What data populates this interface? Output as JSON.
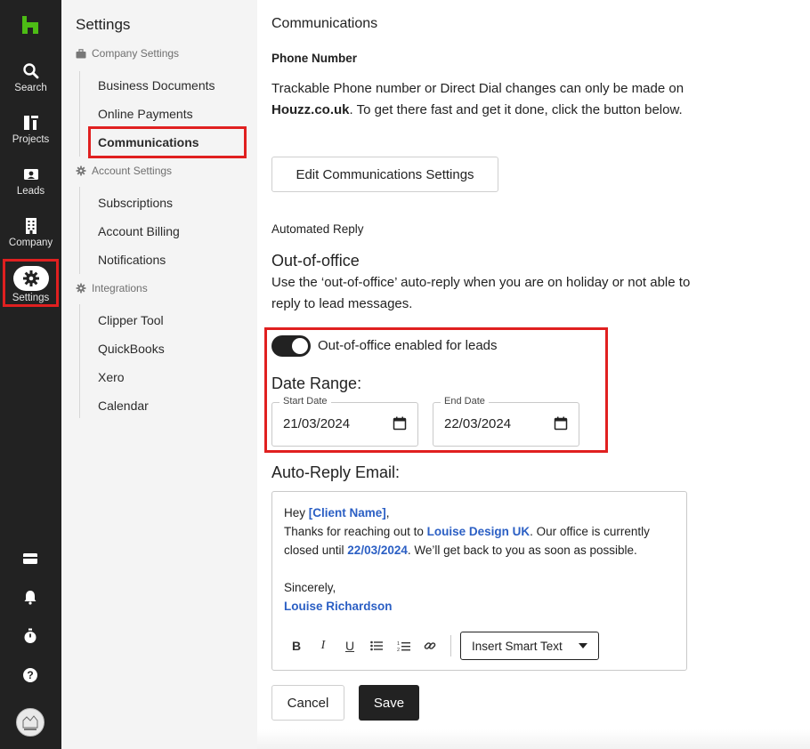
{
  "rail": {
    "items": [
      {
        "label": "Search",
        "icon": "search-icon"
      },
      {
        "label": "Projects",
        "icon": "projects-icon"
      },
      {
        "label": "Leads",
        "icon": "leads-icon"
      },
      {
        "label": "Company",
        "icon": "company-icon"
      },
      {
        "label": "Settings",
        "icon": "gear-icon"
      }
    ],
    "bottom_icons": [
      "inbox-icon",
      "bell-icon",
      "timer-icon",
      "help-icon",
      "avatar"
    ]
  },
  "settings_nav": {
    "title": "Settings",
    "groups": [
      {
        "label": "Company Settings",
        "items": [
          "Business Documents",
          "Online Payments",
          "Communications"
        ]
      },
      {
        "label": "Account Settings",
        "items": [
          "Subscriptions",
          "Account Billing",
          "Notifications"
        ]
      },
      {
        "label": "Integrations",
        "items": [
          "Clipper Tool",
          "QuickBooks",
          "Xero",
          "Calendar"
        ]
      }
    ]
  },
  "main": {
    "title": "Communications",
    "phone_heading": "Phone Number",
    "phone_text_pre": "Trackable Phone number or Direct Dial changes can only be made on ",
    "phone_text_bold": "Houzz.co.uk",
    "phone_text_post": ". To get there fast and get it done, click the button below.",
    "edit_button": "Edit Communications Settings",
    "automated_heading": "Automated Reply",
    "ooo_heading": "Out-of-office",
    "ooo_text": "Use the ‘out-of-office’ auto-reply when you are on holiday or not able to reply to lead messages.",
    "toggle_label": "Out-of-office enabled for leads",
    "toggle_on": true,
    "date_range_heading": "Date Range:",
    "start_date_label": "Start Date",
    "start_date_value": "21/03/2024",
    "end_date_label": "End Date",
    "end_date_value": "22/03/2024",
    "auto_reply_heading": "Auto-Reply Email:",
    "email": {
      "greeting": "Hey ",
      "client_name": "[Client Name]",
      "greeting_end": ",",
      "line2_pre": "Thanks for reaching out to ",
      "company": "Louise Design UK",
      "line2_post": ". Our office is currently closed until ",
      "until_date": "22/03/2024",
      "line2_end": ". We’ll get back to you as soon as possible.",
      "signoff": "Sincerely,",
      "signature": "Louise Richardson"
    },
    "toolbar": {
      "bold": "B",
      "italic": "I",
      "underline": "U",
      "smart_text_button": "Insert Smart Text"
    },
    "cancel_button": "Cancel",
    "save_button": "Save"
  },
  "colors": {
    "rail_bg": "#222222",
    "brand_green": "#4dbc15",
    "highlight_red": "#e02020",
    "smart_text_blue": "#2b5fc4"
  }
}
